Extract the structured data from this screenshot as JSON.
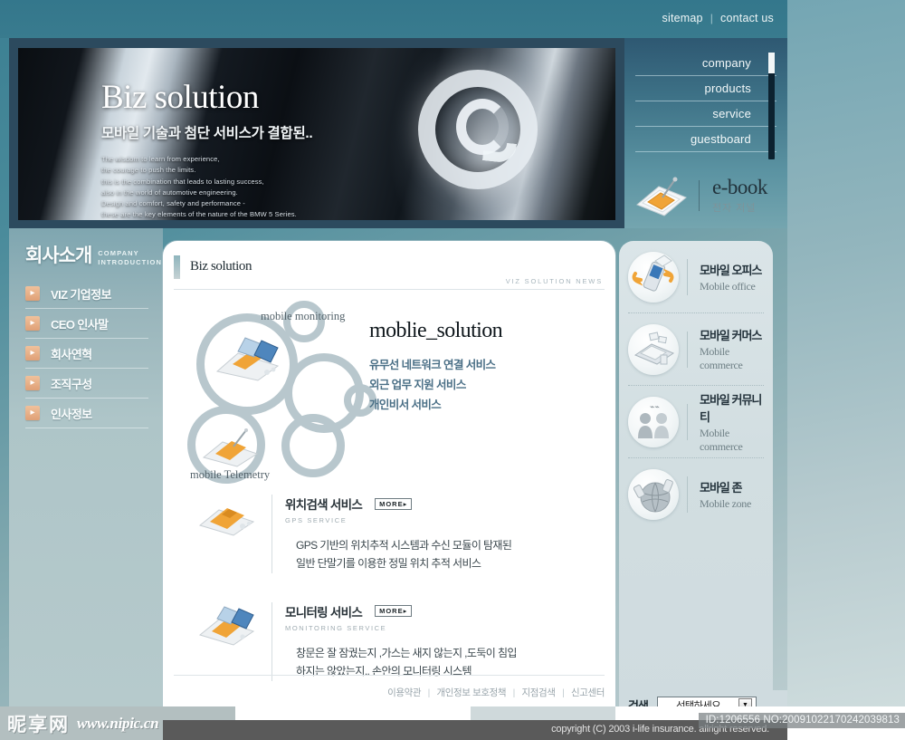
{
  "topbar": {
    "sitemap": "sitemap",
    "separator": "|",
    "contact": "contact us"
  },
  "hero": {
    "title": "Biz solution",
    "subtitle": "모바일 기술과 첨단 서비스가 결합된..",
    "body": "The wisdom to learn from experience,\nthe courage to push the limits.\nthis is the combination that leads to lasting success,\nalso in the world of automotive engineering.\nDesign and comfort, safety and performance -\nthese are the key elements of the nature of the BMW 5 Series."
  },
  "rightnav": {
    "items": [
      {
        "label": "company"
      },
      {
        "label": "products"
      },
      {
        "label": "service"
      },
      {
        "label": "guestboard"
      }
    ]
  },
  "ebook": {
    "title": "e-book",
    "subtitle": "전자 저널",
    "icon": "book-icon"
  },
  "sidebar": {
    "heading_ko": "회사소개",
    "heading_en_line1": "COMPANY",
    "heading_en_line2": "INTRODUCTION",
    "items": [
      {
        "label": "VIZ 기업정보",
        "icon": "chevron-right-icon"
      },
      {
        "label": "CEO 인사말",
        "icon": "chevron-right-icon"
      },
      {
        "label": "회사연혁",
        "icon": "chevron-right-icon"
      },
      {
        "label": "조직구성",
        "icon": "chevron-right-icon"
      },
      {
        "label": "인사정보",
        "icon": "chevron-right-icon"
      }
    ]
  },
  "main": {
    "title": "Biz solution",
    "eyebrow": "VIZ SOLUTION NEWS",
    "solution": {
      "bubble_label_top": "mobile monitoring",
      "bubble_label_bottom": "mobile Telemetry",
      "heading": "moblie_solution",
      "features": [
        "유무선 네트워크 연결 서비스",
        "외근 업무 지원 서비스",
        "개인비서 서비스"
      ]
    },
    "services": [
      {
        "title_ko": "위치검색 서비스",
        "title_en": "GPS SERVICE",
        "more_label": "MORE",
        "more_arrow": "▸",
        "desc_line1": "GPS 기반의 위치추적 시스템과 수신 모듈이 탐재된",
        "desc_line2": "일반 단말기를 이용한 정밀 위치 추적 서비스",
        "icon": "gps-device-icon"
      },
      {
        "title_ko": "모니터링 서비스",
        "title_en": "MONITORING SERVICE",
        "more_label": "MORE",
        "more_arrow": "▸",
        "desc_line1": "창문은 잘 잠궜는지 ,가스는 새지 않는지 ,도둑이 침입",
        "desc_line2": "하지는 않았는지.. 손안의 모니터링 시스템",
        "icon": "monitor-device-icon"
      }
    ],
    "footer_links": [
      "이용약관",
      "개인정보 보호정책",
      "지점검색",
      "신고센터"
    ],
    "footer_sep": "|"
  },
  "rightpanel": {
    "items": [
      {
        "ko": "모바일 오피스",
        "en": "Mobile office",
        "icon": "mobile-office-icon"
      },
      {
        "ko": "모바일 커머스",
        "en": "Mobile commerce",
        "icon": "mobile-commerce-icon"
      },
      {
        "ko": "모바일 커뮤니티",
        "en": "Mobile commerce",
        "icon": "mobile-community-icon"
      },
      {
        "ko": "모바일 존",
        "en": "Mobile zone",
        "icon": "mobile-zone-icon"
      }
    ]
  },
  "search": {
    "label": "검색",
    "selected": "선택하세요",
    "arrow": "▼"
  },
  "footer": {
    "copyright": "copyright (C) 2003 i-life insurance. allright reserved."
  },
  "watermark": {
    "cn": "昵享网",
    "url": "www.nipic.cn",
    "id_stamp": "ID:1206556 NO:20091022170242039813"
  },
  "colors": {
    "teal_header": "#34778c",
    "sidebar": "#aec5c8",
    "accent_orange": "#e0a076",
    "panel_bg": "#d2dee1",
    "copy_band": "#5a5a5a"
  }
}
